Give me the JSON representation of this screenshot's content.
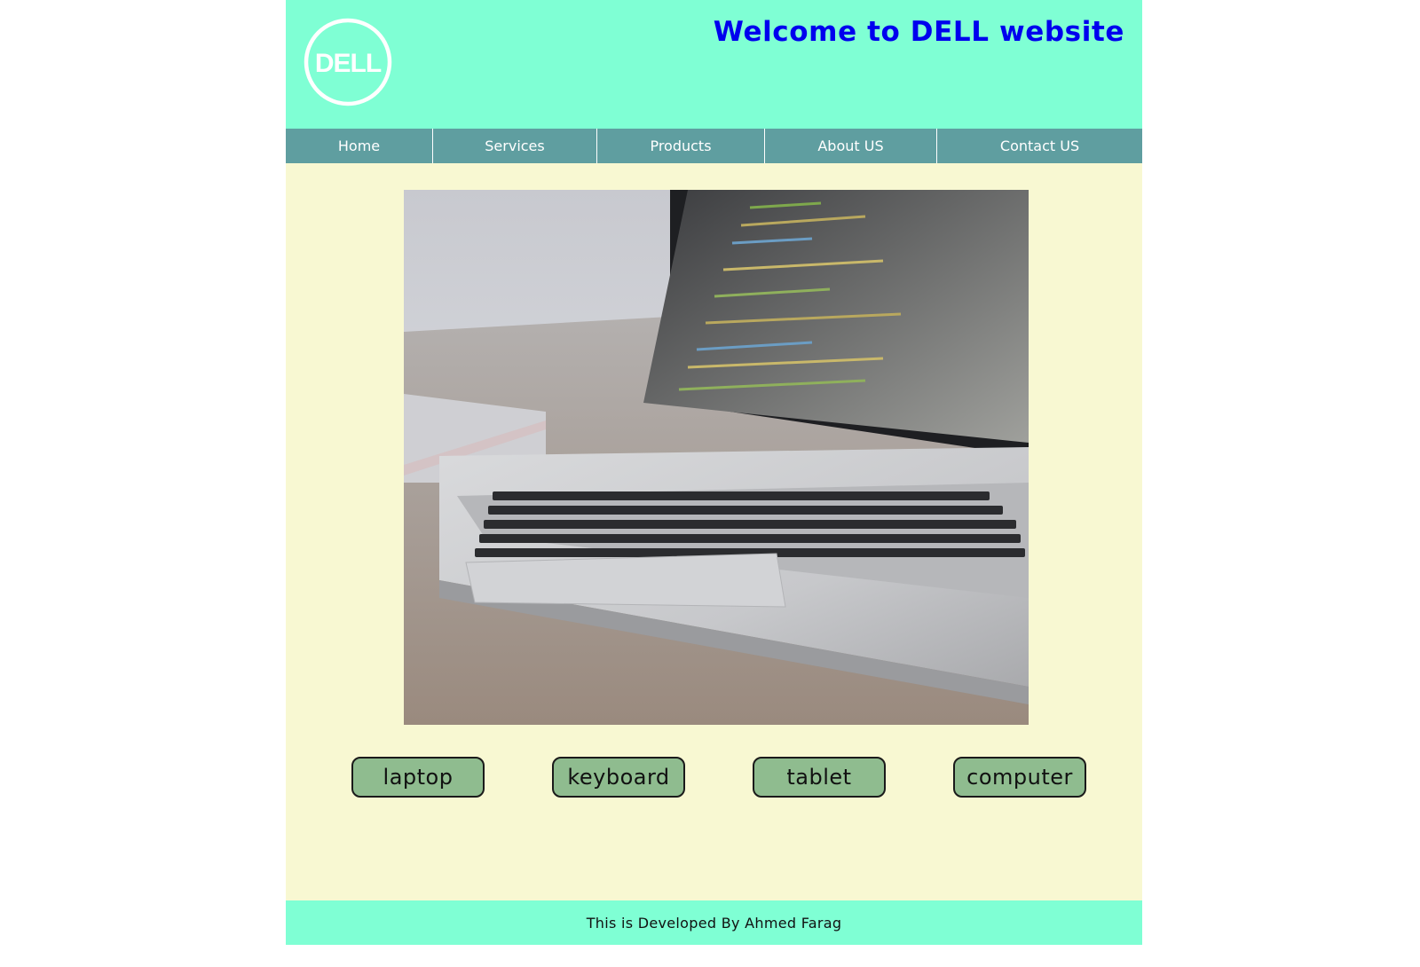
{
  "header": {
    "logo": {
      "text": "DELL",
      "icon": "dell-logo-icon"
    },
    "title": "Welcome to DELL website"
  },
  "nav": {
    "items": [
      {
        "label": "Home"
      },
      {
        "label": "Services"
      },
      {
        "label": "Products"
      },
      {
        "label": "About US"
      },
      {
        "label": "Contact US"
      }
    ]
  },
  "main": {
    "hero_image": "laptop-with-code-photo",
    "buttons": [
      {
        "label": "laptop"
      },
      {
        "label": "keyboard"
      },
      {
        "label": "tablet"
      },
      {
        "label": "computer"
      }
    ]
  },
  "footer": {
    "text": "This is Developed By Ahmed Farag"
  },
  "colors": {
    "header_bg": "#7fffd4",
    "nav_bg": "#5f9ea0",
    "main_bg": "#f8f8d2",
    "title": "#0000ee",
    "button_bg": "#8fbc8f"
  }
}
